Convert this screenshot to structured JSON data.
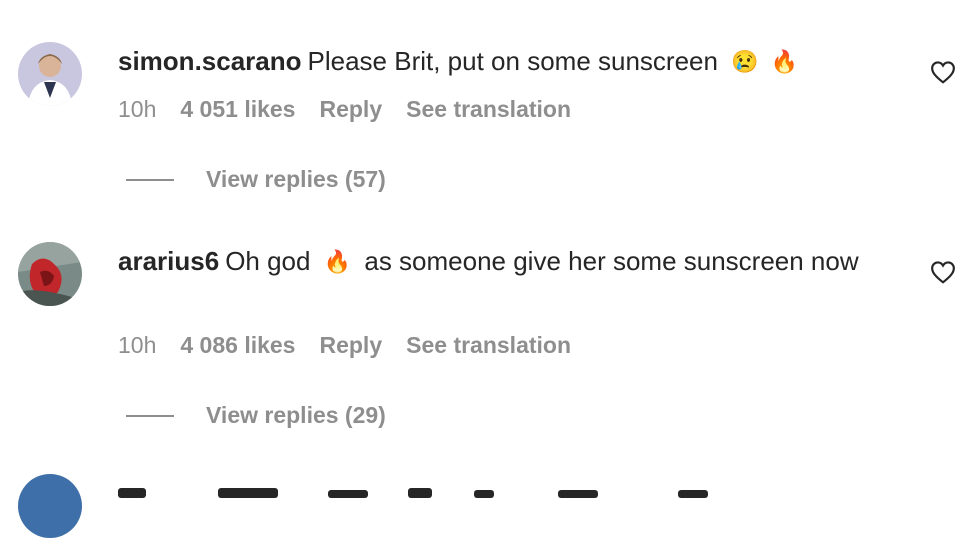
{
  "comments": [
    {
      "username": "simon.scarano",
      "text": "Please Brit, put on some sunscreen",
      "emojis": [
        "😢",
        "🔥"
      ],
      "time": "10h",
      "likes": "4 051 likes",
      "reply_label": "Reply",
      "translate_label": "See translation",
      "view_replies": "View replies (57)"
    },
    {
      "username": "ararius6",
      "text_before": "Oh god",
      "emoji": "🔥",
      "text_after": "as someone give her some sunscreen now",
      "time": "10h",
      "likes": "4 086 likes",
      "reply_label": "Reply",
      "translate_label": "See translation",
      "view_replies": "View replies (29)"
    }
  ],
  "colors": {
    "meta": "#8e8e8e",
    "text": "#262626"
  },
  "icons": {
    "like": "heart-outline-icon"
  }
}
